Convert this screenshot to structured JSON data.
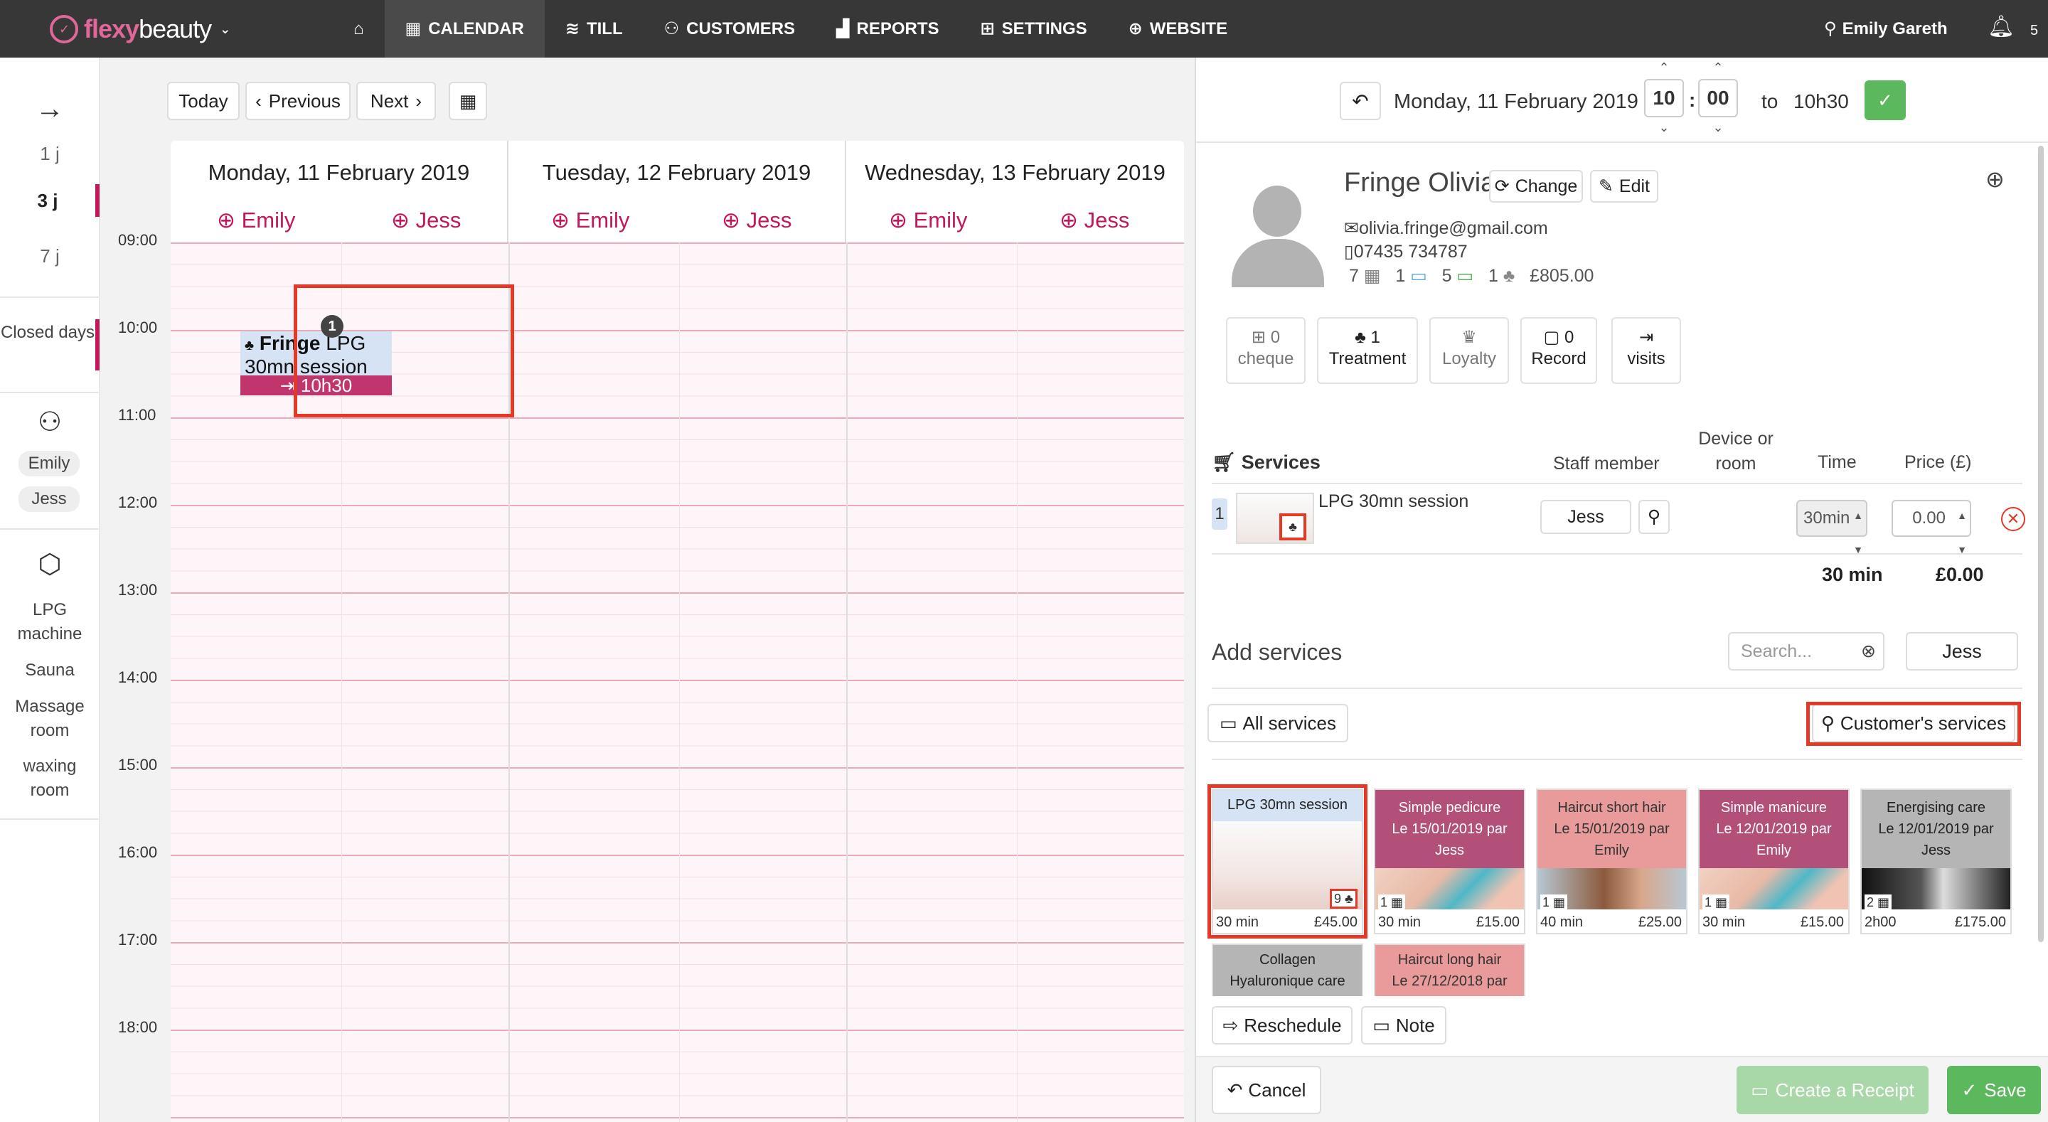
{
  "app": {
    "name_part1": "flexy",
    "name_part2": "beauty"
  },
  "nav": [
    {
      "icon": "home-icon",
      "label": ""
    },
    {
      "icon": "calendar-icon",
      "label": "CALENDAR"
    },
    {
      "icon": "till-icon",
      "label": "TILL"
    },
    {
      "icon": "customers-icon",
      "label": "CUSTOMERS"
    },
    {
      "icon": "reports-icon",
      "label": "REPORTS"
    },
    {
      "icon": "settings-icon",
      "label": "SETTINGS"
    },
    {
      "icon": "website-icon",
      "label": "WEBSITE"
    }
  ],
  "user": {
    "name": "Emily Gareth",
    "notifications": "5"
  },
  "leftbar": {
    "views": [
      "1 j",
      "3 j",
      "7 j"
    ],
    "closed_days": "Closed days",
    "staff": [
      "Emily",
      "Jess"
    ],
    "resources": [
      "LPG machine",
      "Sauna",
      "Massage room",
      "waxing room"
    ]
  },
  "toolbar": {
    "today": "Today",
    "previous": "Previous",
    "next": "Next"
  },
  "days": [
    {
      "title": "Monday, 11 February 2019",
      "staff": [
        "Emily",
        "Jess"
      ]
    },
    {
      "title": "Tuesday, 12 February 2019",
      "staff": [
        "Emily",
        "Jess"
      ]
    },
    {
      "title": "Wednesday, 13 February 2019",
      "staff": [
        "Emily",
        "Jess"
      ]
    }
  ],
  "hours": [
    "09:00",
    "10:00",
    "11:00",
    "12:00",
    "13:00",
    "14:00",
    "15:00",
    "16:00",
    "17:00",
    "18:00"
  ],
  "appointment": {
    "badge": "1",
    "client": "Fringe",
    "service": "LPG 30mn session",
    "time": "10h30"
  },
  "panel": {
    "date": "Monday, 11 February 2019",
    "hour": "10",
    "minute": "00",
    "to_label": "to",
    "end_time": "10h30",
    "customer": {
      "name": "Fringe Olivia",
      "change": "Change",
      "edit": "Edit",
      "email": "olivia.fringe@gmail.com",
      "phone": "07435 734787",
      "stat_appointments": "7",
      "stat_cards": "1",
      "stat_giftcards": "5",
      "stat_treatments": "1",
      "stat_spent": "£805.00"
    },
    "stats": [
      {
        "icon": "gift-icon",
        "count": "0",
        "label": "cheque"
      },
      {
        "icon": "treatment-icon",
        "count": "1",
        "label": "Treatment"
      },
      {
        "icon": "trophy-icon",
        "count": "",
        "label": "Loyalty"
      },
      {
        "icon": "file-icon",
        "count": "0",
        "label": "Record"
      },
      {
        "icon": "signin-icon",
        "count": "",
        "label": "visits"
      }
    ],
    "services_header": {
      "title": "Services",
      "staff": "Staff member",
      "device1": "Device or",
      "device2": "room",
      "time": "Time",
      "price": "Price (£)"
    },
    "service_row": {
      "index": "1",
      "name": "LPG 30mn session",
      "staff": "Jess",
      "time": "30min",
      "price": "0.00"
    },
    "totals": {
      "time": "30 min",
      "price": "£0.00"
    },
    "add_services": "Add services",
    "search_placeholder": "Search...",
    "staff_filter": "Jess",
    "all_services": "All services",
    "customer_services": "Customer's services",
    "tiles": [
      {
        "title": "LPG 30mn session",
        "sub1": "",
        "sub2": "",
        "count": "9",
        "duration": "30 min",
        "price": "£45.00",
        "color": "#d5e3f5",
        "text": "#222"
      },
      {
        "title": "Simple pedicure",
        "sub1": "Le 15/01/2019 par",
        "sub2": "Jess",
        "count": "1",
        "duration": "30 min",
        "price": "£15.00",
        "color": "#b2507a",
        "text": "#fff"
      },
      {
        "title": "Haircut short hair",
        "sub1": "Le 15/01/2019 par",
        "sub2": "Emily",
        "count": "1",
        "duration": "40 min",
        "price": "£25.00",
        "color": "#e99a9a",
        "text": "#333"
      },
      {
        "title": "Simple manicure",
        "sub1": "Le 12/01/2019 par",
        "sub2": "Emily",
        "count": "1",
        "duration": "30 min",
        "price": "£15.00",
        "color": "#b2507a",
        "text": "#fff"
      },
      {
        "title": "Energising care",
        "sub1": "Le 12/01/2019 par",
        "sub2": "Jess",
        "count": "2",
        "duration": "2h00",
        "price": "£175.00",
        "color": "#b5b5b5",
        "text": "#222"
      },
      {
        "title": "Collagen",
        "sub1": "Hyaluronique care",
        "sub2": "",
        "count": "",
        "duration": "",
        "price": "",
        "color": "#b5b5b5",
        "text": "#222"
      },
      {
        "title": "Haircut long hair",
        "sub1": "Le 27/12/2018 par",
        "sub2": "",
        "count": "",
        "duration": "",
        "price": "",
        "color": "#e99a9a",
        "text": "#333"
      }
    ],
    "reschedule": "Reschedule",
    "note": "Note",
    "cancel": "Cancel",
    "create_receipt": "Create a Receipt",
    "save": "Save"
  }
}
